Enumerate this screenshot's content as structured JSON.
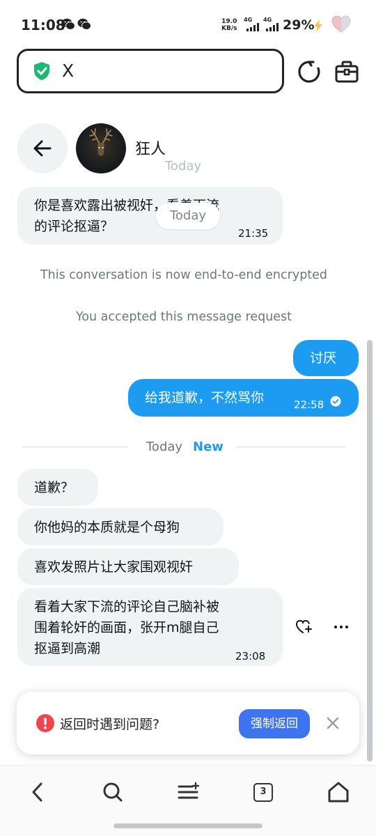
{
  "status_bar": {
    "time": "11:08",
    "net_speed_value": "19.0",
    "net_speed_unit": "KB/s",
    "signal_1": "4G",
    "signal_2": "4G",
    "battery": "29%"
  },
  "browser": {
    "url": "X",
    "icons": [
      "shield-check-icon",
      "reload-icon",
      "briefcase-icon"
    ]
  },
  "chat": {
    "contact_name": "狂人",
    "header_date_ghost": "Today",
    "floating_date_pill": "Today",
    "messages": [
      {
        "direction": "in",
        "text_line1": "你是喜欢露出被视奸，看着下流",
        "text_line2": "的评论抠逼？",
        "time": "21:35"
      },
      {
        "direction": "out",
        "text": "讨厌"
      },
      {
        "direction": "out",
        "text": "给我道歉，不然骂你",
        "time": "22:58"
      },
      {
        "direction": "in",
        "text": "道歉？"
      },
      {
        "direction": "in",
        "text": "你他妈的本质就是个母狗"
      },
      {
        "direction": "in",
        "text": "喜欢发照片让大家围观视奸"
      },
      {
        "direction": "in",
        "text_line1": "看着大家下流的评论自己脑补被",
        "text_line2": "围着轮奸的画面，张开m腿自己",
        "text_line3": "抠逼到高潮",
        "time": "23:08"
      }
    ],
    "system_messages": {
      "encrypted": "This conversation is now end-to-end encrypted",
      "accepted": "You accepted this message request"
    },
    "divider": {
      "today": "Today",
      "new": "New"
    }
  },
  "toast": {
    "text": "返回时遇到问题?",
    "button": "强制返回"
  },
  "bottom_nav": {
    "tab_count": "3",
    "icons": [
      "back-icon",
      "search-icon",
      "menu-icon",
      "tabs-icon",
      "home-icon"
    ]
  },
  "colors": {
    "accent_blue": "#1d9bf0",
    "incoming_bubble": "#eff3f4",
    "toast_button": "#3f74f0",
    "alert_red": "#f0454f",
    "shield_green": "#1fb778"
  }
}
